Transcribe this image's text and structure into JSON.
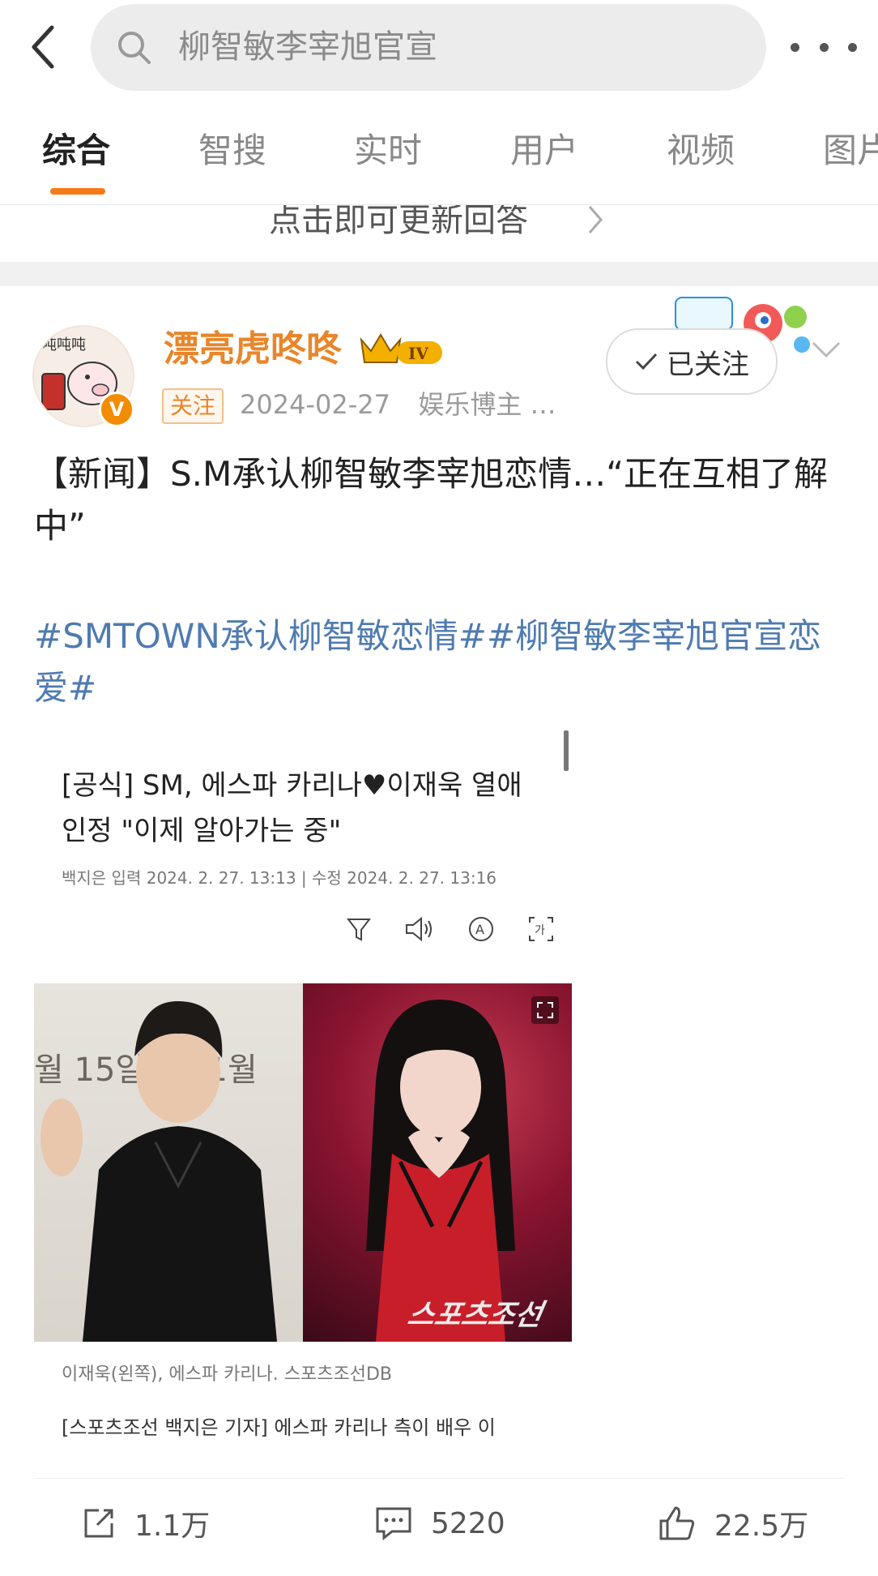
{
  "search": {
    "query": "柳智敏李宰旭官宣"
  },
  "tabs": [
    {
      "label": "综合",
      "active": true
    },
    {
      "label": "智搜"
    },
    {
      "label": "实时"
    },
    {
      "label": "用户"
    },
    {
      "label": "视频"
    },
    {
      "label": "图片"
    }
  ],
  "update_prompt": "点击即可更新回答",
  "post": {
    "author": "漂亮虎咚咚",
    "follow_tag": "关注",
    "date": "2024-02-27",
    "role": "娱乐博主 …",
    "followed_label": "已关注",
    "text": "【新闻】S.M承认柳智敏李宰旭恋情…“正在互相了解中”",
    "hashtags": "#SMTOWN承认柳智敏恋情##柳智敏李宰旭官宣恋爱#",
    "article": {
      "title": "[공식] SM, 에스파 카리나♥이재욱 열애 인정 \"이제 알아가는 중\"",
      "meta": "백지은  입력  2024. 2. 27. 13:13  |  수정  2024. 2. 27. 13:16",
      "photo_caption": "이재욱(왼쪽), 에스파 카리나. 스포츠조선DB",
      "body": "[스포츠조선 백지은 기자] 에스파 카리나 측이 배우 이",
      "left_photo_backdrop": "월 15일  1 · 1월",
      "right_photo_watermark": "스포츠조선"
    },
    "actions": {
      "repost": "1.1万",
      "comment": "5220",
      "like": "22.5万"
    }
  },
  "colors": {
    "accent": "#f57a18",
    "author": "#e8862a",
    "hashtag": "#4f7bb0"
  }
}
